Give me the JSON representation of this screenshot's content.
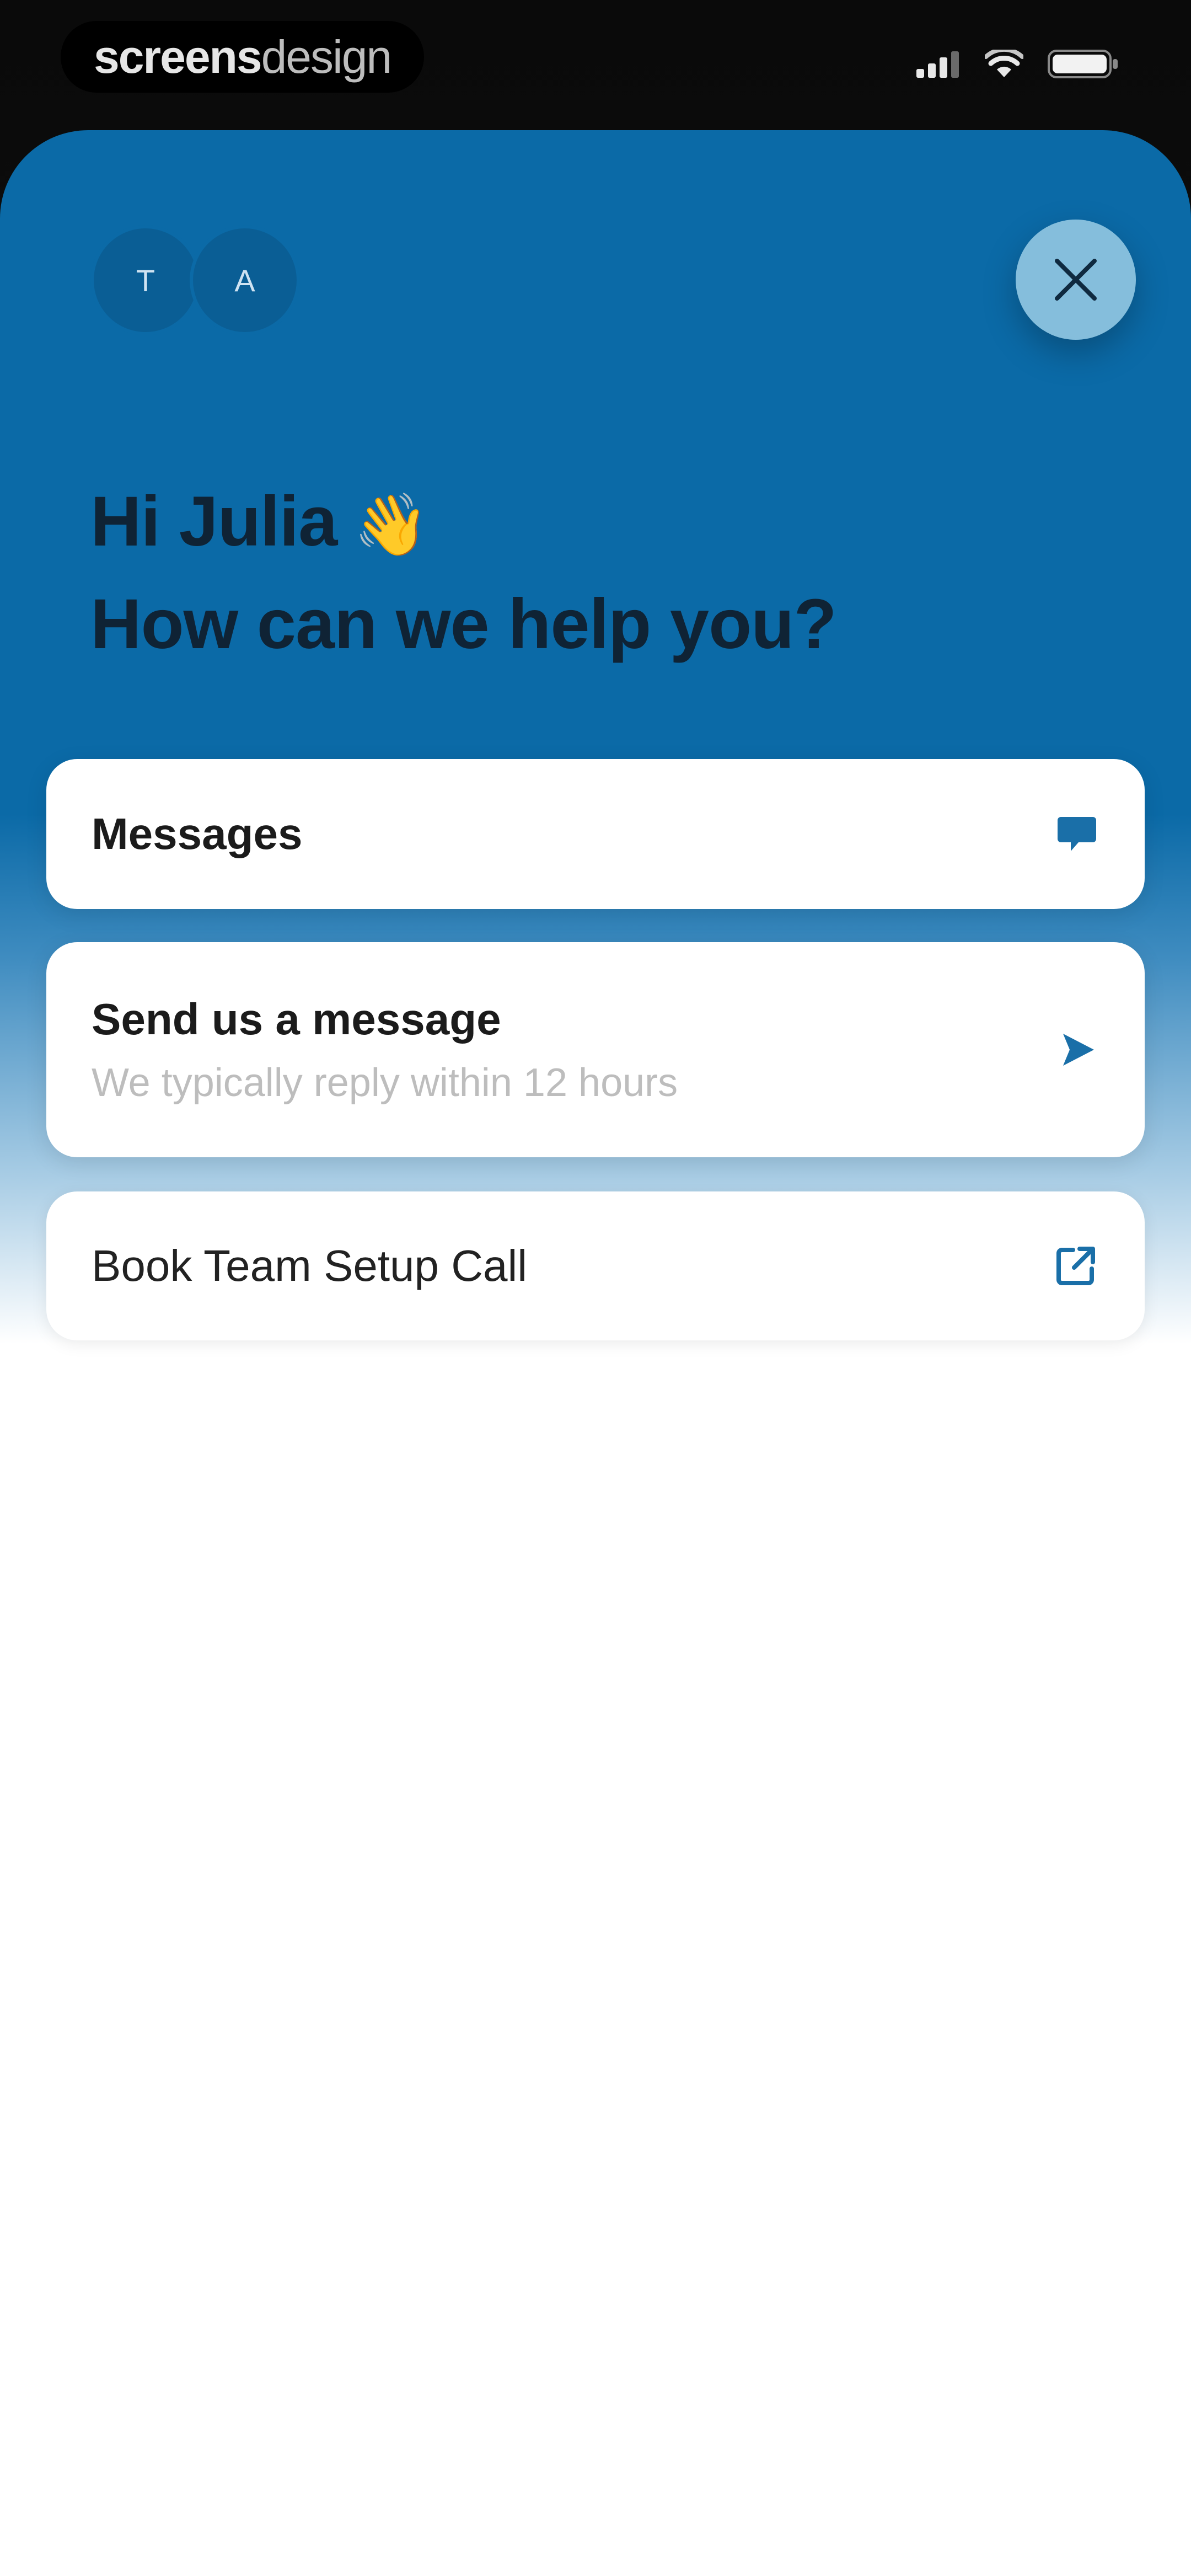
{
  "status_bar": {
    "brand_bold": "screens",
    "brand_light": "design",
    "signal_icon": "cellular-signal-icon",
    "wifi_icon": "wifi-icon",
    "battery_icon": "battery-icon"
  },
  "header": {
    "avatars": [
      {
        "initial": "T"
      },
      {
        "initial": "A"
      }
    ],
    "close_icon": "close-icon",
    "greeting_line1": "Hi Julia",
    "wave_emoji": "👋",
    "greeting_line2": "How can we help you?"
  },
  "cards": {
    "messages": {
      "title": "Messages",
      "icon": "chat-bubble-icon"
    },
    "send_message": {
      "title": "Send us a message",
      "subtitle": "We typically reply within 12 hours",
      "icon": "send-arrow-icon"
    },
    "book_call": {
      "title": "Book Team Setup Call",
      "icon": "external-link-icon"
    }
  },
  "colors": {
    "primary_blue": "#0b6aa7",
    "close_button": "#85bedc",
    "icon_blue": "#1a6fa8"
  }
}
